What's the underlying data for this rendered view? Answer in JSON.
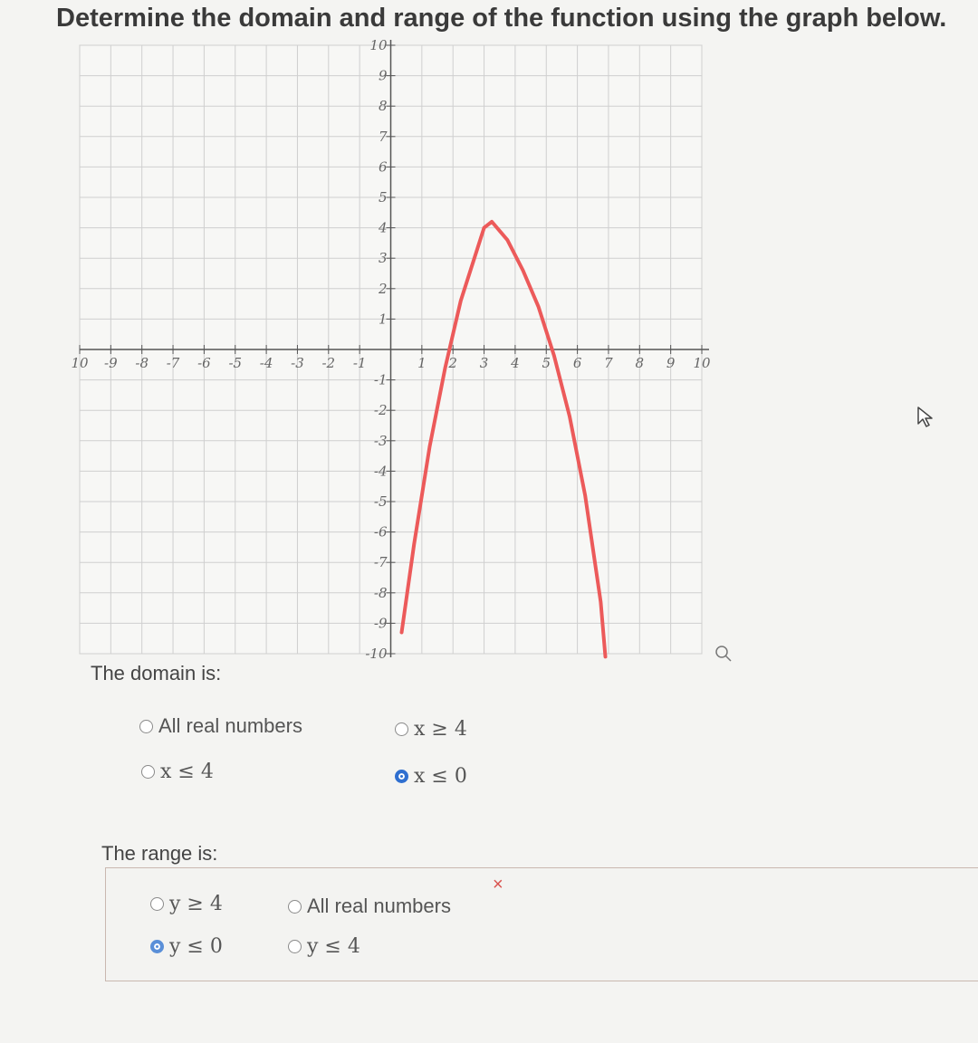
{
  "question": "Determine the domain and range of the function using the graph below.",
  "chart_data": {
    "type": "line",
    "xlim": [
      -10,
      10
    ],
    "ylim": [
      -10,
      10
    ],
    "grid": true,
    "x_tick_labels": [
      "10",
      "-9",
      "-8",
      "-7",
      "-6",
      "-5",
      "-4",
      "-3",
      "-2",
      "-1",
      "1",
      "2",
      "3",
      "4",
      "5",
      "6",
      "7",
      "8",
      "9",
      "10"
    ],
    "y_tick_labels": [
      "10",
      "9",
      "8",
      "7",
      "6",
      "5",
      "4",
      "3",
      "2",
      "1",
      "-1",
      "-2",
      "-3",
      "-4",
      "-5",
      "-6",
      "-7",
      "-8",
      "-9",
      "-10"
    ],
    "series": [
      {
        "color": "#ec5a5a",
        "x": [
          0.35,
          0.75,
          1.25,
          1.75,
          2.25,
          2.75,
          3,
          3.25,
          3.75,
          4.25,
          4.75,
          5.25,
          5.75,
          6.25,
          6.75,
          6.9
        ],
        "y": [
          -9.3,
          -6.4,
          -3.2,
          -0.6,
          1.6,
          3.2,
          4,
          4.2,
          3.6,
          2.6,
          1.4,
          -0.2,
          -2.2,
          -4.8,
          -8.3,
          -10.1
        ]
      }
    ]
  },
  "domain": {
    "label": "The domain is:",
    "options": [
      {
        "text": "All real numbers",
        "selected": false
      },
      {
        "text": "x ≥ 4",
        "selected": false
      },
      {
        "text": "x ≤ 4",
        "selected": false
      },
      {
        "text": "x ≤ 0",
        "selected": true
      }
    ]
  },
  "range": {
    "label": "The range is:",
    "options": [
      {
        "text": "y ≥ 4",
        "selected": false
      },
      {
        "text": "All real numbers",
        "selected": false
      },
      {
        "text": "y ≤ 0",
        "selected": true
      },
      {
        "text": "y ≤ 4",
        "selected": false
      }
    ],
    "feedback_mark": "×"
  },
  "colors": {
    "accent": "#2f6fd0",
    "curve": "#ec5a5a",
    "error": "#d9534f"
  }
}
